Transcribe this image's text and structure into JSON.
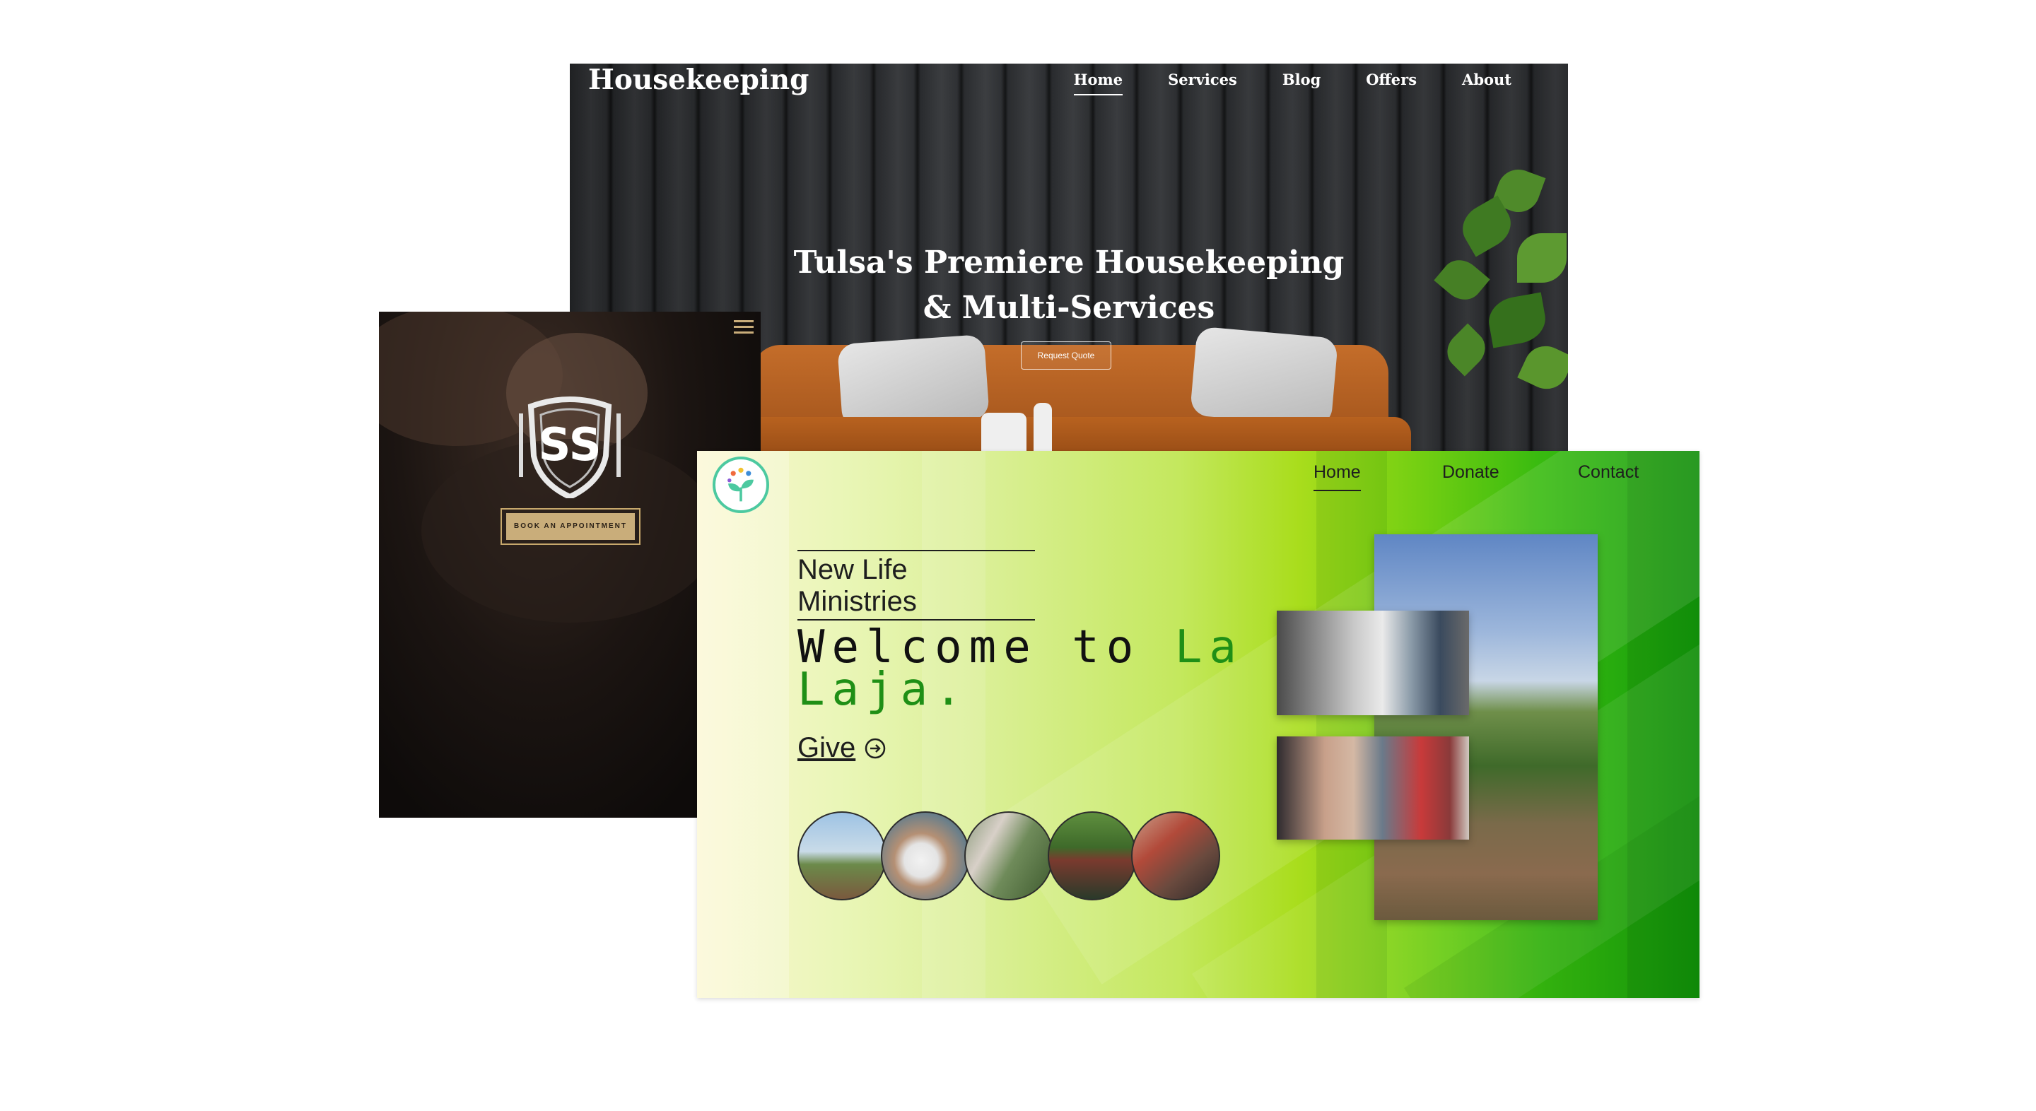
{
  "housekeeping": {
    "logo": "Housekeeping",
    "nav": [
      "Home",
      "Services",
      "Blog",
      "Offers",
      "About"
    ],
    "active_nav": "Home",
    "headline_line1": "Tulsa's Premiere Housekeeping",
    "headline_line2": "& Multi-Services",
    "cta": "Request Quote"
  },
  "barber": {
    "menu_icon": "hamburger-icon",
    "crest_icon": "barber-crest-logo",
    "cta": "BOOK AN APPOINTMENT",
    "accent_color": "#c9ad7a"
  },
  "laja": {
    "logo_icon": "sprout-logo",
    "nav": [
      "Home",
      "Donate",
      "Contact"
    ],
    "active_nav": "Home",
    "brand": "New Life Ministries",
    "welcome_a": "Welcome to ",
    "welcome_b": "La",
    "welcome_c": "Laja.",
    "give": "Give",
    "give_icon": "arrow-circle-icon",
    "accent_color": "#1f8f16"
  }
}
